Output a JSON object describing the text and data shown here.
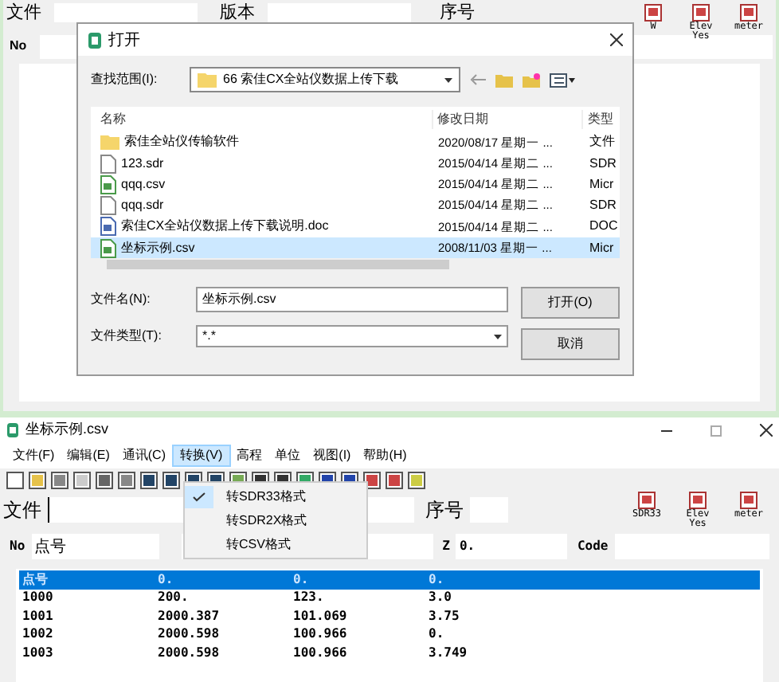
{
  "top_window": {
    "labels": [
      "文件",
      "版本",
      "序号"
    ],
    "no_label": "No",
    "tool_icons": [
      {
        "lines": [
          "W"
        ]
      },
      {
        "lines": [
          "Elev",
          "Yes"
        ]
      },
      {
        "lines": [
          "meter"
        ]
      }
    ]
  },
  "dialog": {
    "title": "打开",
    "look_in_label": "查找范围(I):",
    "look_in_value": "66  索佳CX全站仪数据上传下载",
    "columns": [
      "名称",
      "修改日期",
      "类型"
    ],
    "files": [
      {
        "name": "索佳全站仪传输软件",
        "date": "2020/08/17 星期一 ...",
        "type": "文件",
        "kind": "folder",
        "selected": false
      },
      {
        "name": "123.sdr",
        "date": "2015/04/14 星期二 ...",
        "type": "SDR",
        "kind": "file",
        "selected": false
      },
      {
        "name": "qqq.csv",
        "date": "2015/04/14 星期二 ...",
        "type": "Micr",
        "kind": "csv",
        "selected": false
      },
      {
        "name": "qqq.sdr",
        "date": "2015/04/14 星期二 ...",
        "type": "SDR",
        "kind": "file",
        "selected": false
      },
      {
        "name": "索佳CX全站仪数据上传下载说明.doc",
        "date": "2015/04/14 星期二 ...",
        "type": "DOC",
        "kind": "doc",
        "selected": false
      },
      {
        "name": "坐标示例.csv",
        "date": "2008/11/03 星期一 ...",
        "type": "Micr",
        "kind": "csv",
        "selected": true
      }
    ],
    "filename_label": "文件名(N):",
    "filename_value": "坐标示例.csv",
    "filetype_label": "文件类型(T):",
    "filetype_value": "*.*",
    "buttons": [
      "打开(O)",
      "取消"
    ]
  },
  "app": {
    "title": "坐标示例.csv",
    "menus": [
      {
        "label": "文件(F)",
        "selected": false
      },
      {
        "label": "编辑(E)",
        "selected": false
      },
      {
        "label": "通讯(C)",
        "selected": false
      },
      {
        "label": "转换(V)",
        "selected": true
      },
      {
        "label": "高程",
        "selected": false
      },
      {
        "label": "单位",
        "selected": false
      },
      {
        "label": "视图(I)",
        "selected": false
      },
      {
        "label": "帮助(H)",
        "selected": false
      }
    ],
    "dropdown": [
      {
        "label": "转SDR33格式",
        "checked": true
      },
      {
        "label": "转SDR2X格式",
        "checked": false
      },
      {
        "label": "转CSV格式",
        "checked": false
      }
    ],
    "file_label": "文件",
    "seq_label": "序号",
    "tool_icons": [
      {
        "lines": [
          "SDR33"
        ]
      },
      {
        "lines": [
          "Elev",
          "Yes"
        ]
      },
      {
        "lines": [
          "meter"
        ]
      }
    ],
    "no_label": "No",
    "point_value": "点号",
    "z_label": "Z",
    "z_value": "0.",
    "code_label": "Code",
    "rows": [
      {
        "cells": [
          "点号",
          "0.",
          "0.",
          "0."
        ],
        "selected": true
      },
      {
        "cells": [
          "1000",
          "200.",
          "123.",
          "3.0"
        ],
        "selected": false
      },
      {
        "cells": [
          "1001",
          "2000.387",
          "101.069",
          "3.75"
        ],
        "selected": false
      },
      {
        "cells": [
          "1002",
          "2000.598",
          "100.966",
          "0."
        ],
        "selected": false
      },
      {
        "cells": [
          "1003",
          "2000.598",
          "100.966",
          "3.749"
        ],
        "selected": false
      }
    ]
  }
}
